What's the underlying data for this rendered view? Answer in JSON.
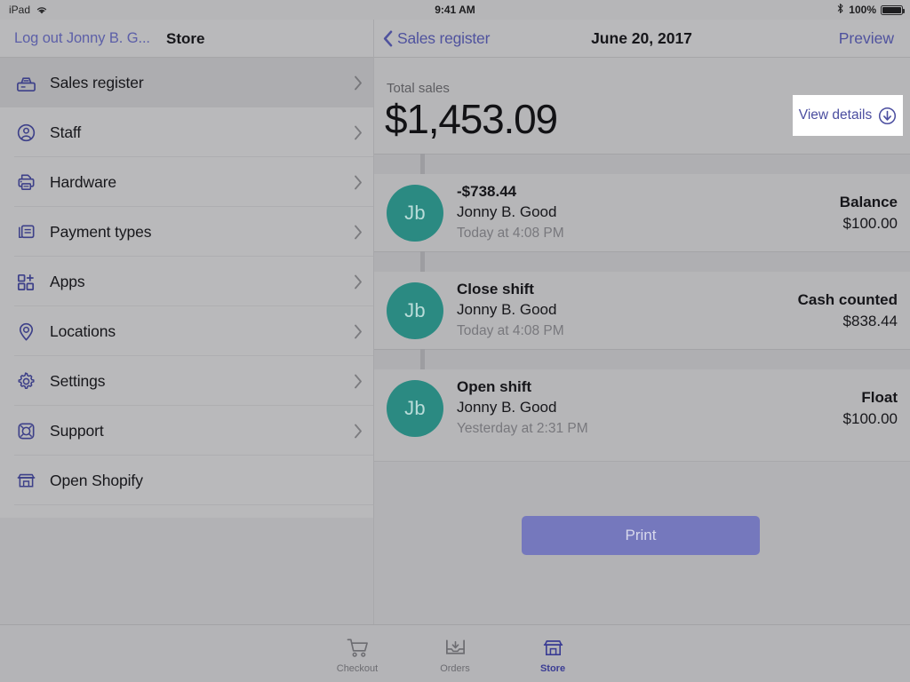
{
  "status_bar": {
    "device": "iPad",
    "wifi_icon": "wifi-icon",
    "time": "9:41 AM",
    "bluetooth_icon": "bluetooth-icon",
    "battery_percent": "100%",
    "battery_icon": "battery-full-icon"
  },
  "left_nav": {
    "logout_label": "Log out Jonny B. G...",
    "title": "Store"
  },
  "right_nav": {
    "back_icon": "chevron-left-icon",
    "back_label": "Sales register",
    "date": "June 20, 2017",
    "preview_label": "Preview"
  },
  "sidebar": {
    "items": [
      {
        "label": "Sales register",
        "icon": "cash-register-icon",
        "active": true,
        "chevron": "chevron-right-icon"
      },
      {
        "label": "Staff",
        "icon": "person-circle-icon",
        "active": false,
        "chevron": "chevron-right-icon"
      },
      {
        "label": "Hardware",
        "icon": "printer-icon",
        "active": false,
        "chevron": "chevron-right-icon"
      },
      {
        "label": "Payment types",
        "icon": "cards-icon",
        "active": false,
        "chevron": "chevron-right-icon"
      },
      {
        "label": "Apps",
        "icon": "apps-grid-plus-icon",
        "active": false,
        "chevron": "chevron-right-icon"
      },
      {
        "label": "Locations",
        "icon": "map-pin-icon",
        "active": false,
        "chevron": "chevron-right-icon"
      },
      {
        "label": "Settings",
        "icon": "gear-icon",
        "active": false,
        "chevron": "chevron-right-icon"
      },
      {
        "label": "Support",
        "icon": "lifebuoy-icon",
        "active": false,
        "chevron": "chevron-right-icon"
      },
      {
        "label": "Open Shopify",
        "icon": "storefront-icon",
        "active": false,
        "chevron": ""
      }
    ]
  },
  "summary": {
    "total_label": "Total sales",
    "total_value": "$1,453.09",
    "view_details_label": "View details",
    "view_details_icon": "circle-arrow-down-icon"
  },
  "transactions": [
    {
      "avatar_initials": "Jb",
      "title": "-$738.44",
      "subtitle": "Jonny B. Good",
      "time": "Today at 4:08 PM",
      "right_label": "Balance",
      "right_amount": "$100.00"
    },
    {
      "avatar_initials": "Jb",
      "title": "Close shift",
      "subtitle": "Jonny B. Good",
      "time": "Today at 4:08 PM",
      "right_label": "Cash counted",
      "right_amount": "$838.44"
    },
    {
      "avatar_initials": "Jb",
      "title": "Open shift",
      "subtitle": "Jonny B. Good",
      "time": "Yesterday at 2:31 PM",
      "right_label": "Float",
      "right_amount": "$100.00"
    }
  ],
  "actions": {
    "print_label": "Print"
  },
  "tab_bar": {
    "tabs": [
      {
        "label": "Checkout",
        "icon": "shopping-cart-icon",
        "active": false
      },
      {
        "label": "Orders",
        "icon": "inbox-download-icon",
        "active": false
      },
      {
        "label": "Store",
        "icon": "storefront-icon",
        "active": true
      }
    ]
  },
  "colors": {
    "accent_indigo": "#4f529e",
    "avatar_teal": "#2b8a82",
    "print_button": "#7578bd",
    "chrome_gray": "#b6b6b8"
  }
}
